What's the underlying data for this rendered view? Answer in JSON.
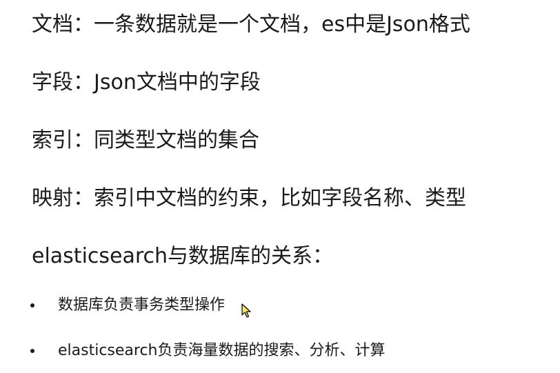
{
  "document": {
    "lines": [
      "文档：一条数据就是一个文档，es中是Json格式",
      "字段：Json文档中的字段",
      "索引：同类型文档的集合",
      "映射：索引中文档的约束，比如字段名称、类型",
      "elasticsearch与数据库的关系："
    ],
    "bullets": [
      "数据库负责事务类型操作",
      "elasticsearch负责海量数据的搜索、分析、计算"
    ]
  },
  "icons": {
    "cursor": "mouse-pointer-icon"
  },
  "colors": {
    "text": "#1a1a1a",
    "background": "#ffffff",
    "cursor_fill": "#f5e663"
  }
}
